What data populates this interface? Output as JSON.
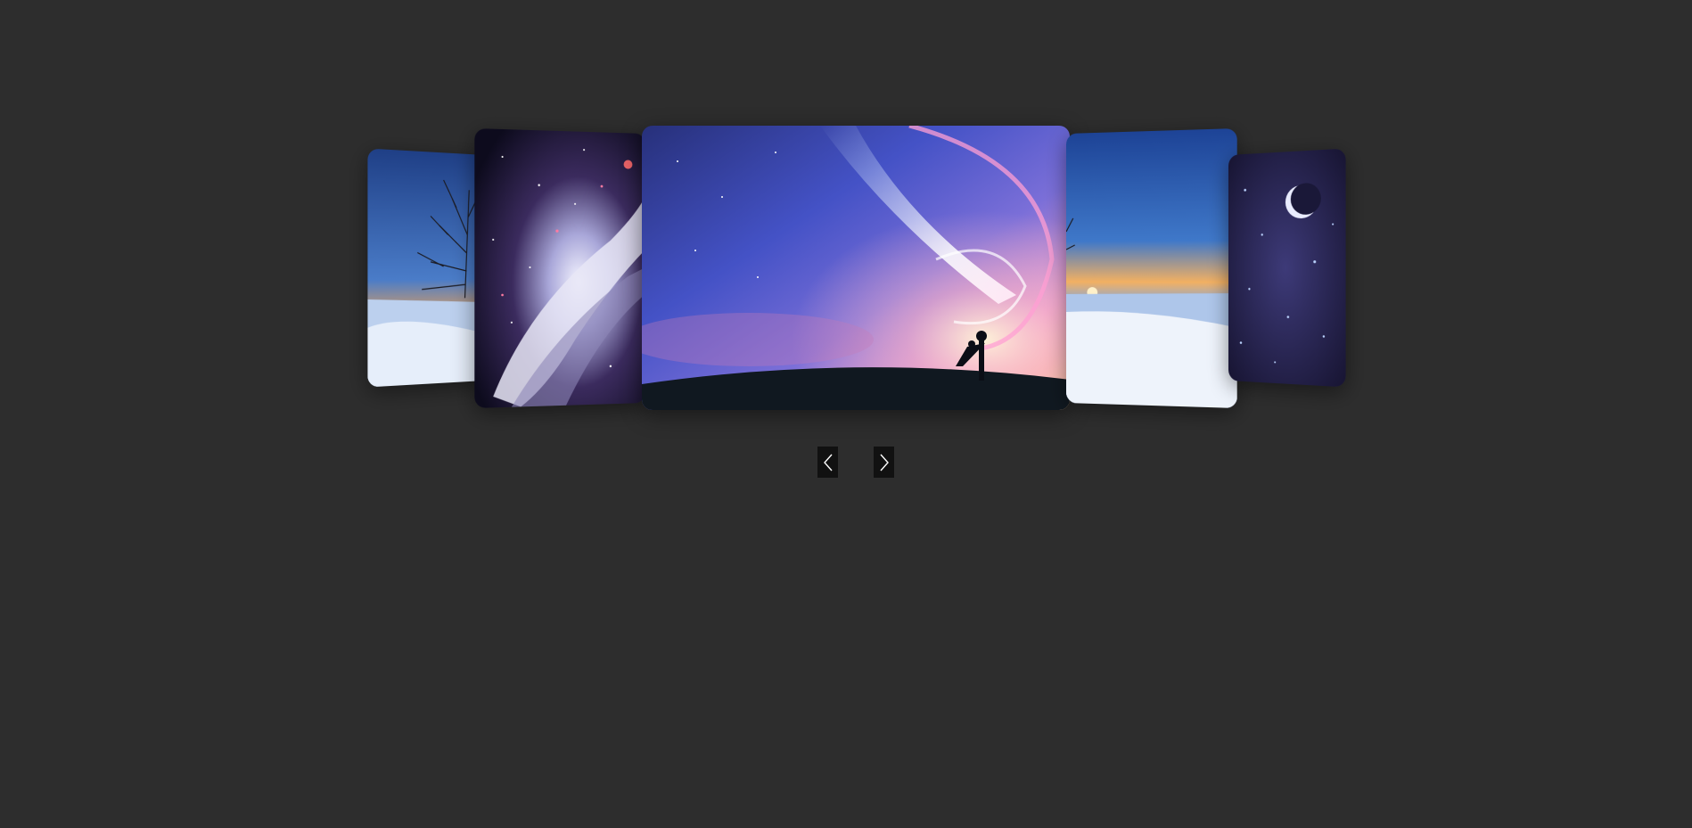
{
  "carousel": {
    "slides": [
      {
        "name": "snow-sunset-tree-far-left",
        "scene": "snow-tree-sunset"
      },
      {
        "name": "galaxy-spiral",
        "scene": "galaxy"
      },
      {
        "name": "anime-couple-comet-sky",
        "scene": "comet-sky",
        "active": true
      },
      {
        "name": "snow-sunset-tree-right",
        "scene": "snow-tree-sunset"
      },
      {
        "name": "crescent-moon-starfield",
        "scene": "moon-stars"
      }
    ],
    "controls": {
      "prev_icon": "chevron-left-icon",
      "next_icon": "chevron-right-icon"
    }
  },
  "colors": {
    "background": "#2d2d2d",
    "button": "#111111",
    "chevron": "#ffffff"
  }
}
